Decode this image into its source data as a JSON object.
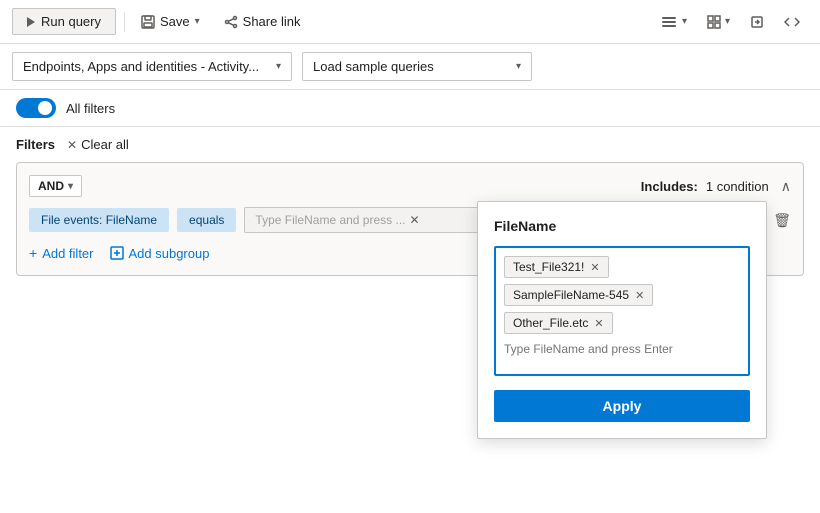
{
  "toolbar": {
    "run_query_label": "Run query",
    "save_label": "Save",
    "share_link_label": "Share link"
  },
  "dropdowns": {
    "source_label": "Endpoints, Apps and identities - Activity...",
    "query_label": "Load sample queries"
  },
  "filters_toggle": {
    "label": "All filters"
  },
  "filters_bar": {
    "label": "Filters",
    "clear_all_label": "Clear all"
  },
  "filter_group": {
    "operator": "AND",
    "includes_label": "Includes:",
    "condition_count": "1 condition",
    "field_label": "File events: FileName",
    "operator_label": "equals",
    "value_placeholder": "Type FileName and press ..."
  },
  "add_buttons": {
    "add_filter_label": "Add filter",
    "add_subgroup_label": "Add subgroup"
  },
  "popup": {
    "title": "FileName",
    "tags": [
      "Test_File321!",
      "SampleFileName-545",
      "Other_File.etc"
    ],
    "input_placeholder": "Type FileName and press Enter",
    "apply_label": "Apply"
  }
}
